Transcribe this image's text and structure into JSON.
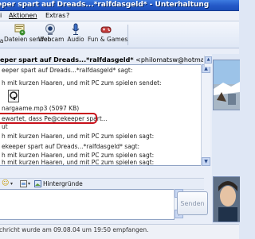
{
  "window": {
    "title": "eper spart auf Dreads...*ralfdasgeld* - Unterhaltung"
  },
  "menu": {
    "items": [
      "Aktionen",
      "Extras",
      "?"
    ],
    "partial_first": "i"
  },
  "toolbar": {
    "buttons": [
      {
        "label": "Dateien senden",
        "icon": "send-files-icon"
      },
      {
        "label": "Webcam",
        "icon": "webcam-icon"
      },
      {
        "label": "Audio",
        "icon": "audio-icon"
      },
      {
        "label": "Fun & Games",
        "icon": "games-icon"
      }
    ],
    "partial_label": "a"
  },
  "conversation": {
    "to_name": "eper spart auf Dreads...*ralfdasgeld*",
    "to_email": "<philomatsw@hotmail.com>",
    "lines": [
      "eeper spart auf Dreads...*ralfdasgeld* sagt:",
      "h mit kurzen Haaren, und mit PC zum spielen sendet:",
      "nargaame.mp3 (5097 KB)",
      "ewartet, dass Pe@cekeeper spart...",
      "ut",
      "h mit kurzen Haaren, und mit PC zum spielen sagt:",
      "ekeeper spart auf Dreads...*ralfdasgeld* sagt:",
      "h mit kurzen Haaren, und mit PC zum spielen sagt:",
      "h mit kurzen Haaren, und mit PC zum spielen sagt:"
    ],
    "highlighted_line": "ewartet, dass Pe@cekeeper spart..."
  },
  "format_bar": {
    "background_label": "Hintergründe"
  },
  "input": {
    "value": ""
  },
  "send": {
    "label": "Senden"
  },
  "status": {
    "text": "chricht wurde am 09.08.04 um 19:50 empfangen."
  },
  "colors": {
    "titlebar": "#2459c7",
    "highlight": "#c8101a"
  }
}
